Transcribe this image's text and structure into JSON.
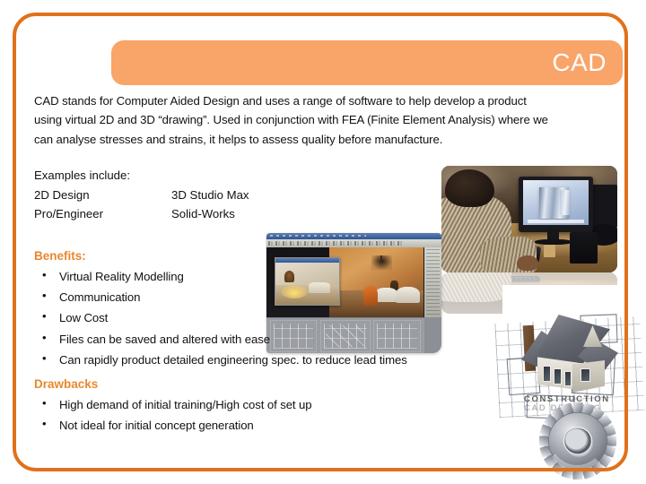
{
  "slide": {
    "title": "CAD",
    "accent_border": "#E0711C",
    "header_fill": "#F9A469",
    "heading_color": "#E8882C",
    "text_color": "#111111"
  },
  "intro": {
    "paragraph": "CAD stands for Computer Aided Design and uses a range of software to help develop a product using virtual 2D and 3D “drawing”. Used in conjunction with FEA (Finite Element Analysis) where we can analyse stresses and strains, it helps to assess quality before manufacture."
  },
  "examples": {
    "heading": "Examples include:",
    "rows": [
      {
        "left": "2D Design",
        "right": "3D Studio Max"
      },
      {
        "left": "Pro/Engineer",
        "right": "Solid-Works"
      }
    ]
  },
  "benefits": {
    "heading": "Benefits:",
    "items": [
      "Virtual Reality Modelling",
      "Communication",
      "Low Cost",
      "Files can be saved and altered with ease",
      "Can rapidly product detailed engineering spec. to reduce lead times"
    ]
  },
  "drawbacks": {
    "heading": "Drawbacks",
    "items": [
      "High demand of initial training/High cost of set up",
      "Not ideal for initial concept generation"
    ]
  },
  "images": {
    "workstation_photo": "photo of a person seated at a desk working on CAD software shown on a computer monitor",
    "software_screenshot": "3D Studio Max software window showing a rendered interior room scene with wireframe viewports",
    "house_render": "3D model of a house sitting on top of construction blueprints",
    "house_caption_line1": "CONSTRUCTION",
    "house_caption_line2": "CAD DRAWING",
    "gear_render": "metallic 3D rendered spur gear"
  }
}
